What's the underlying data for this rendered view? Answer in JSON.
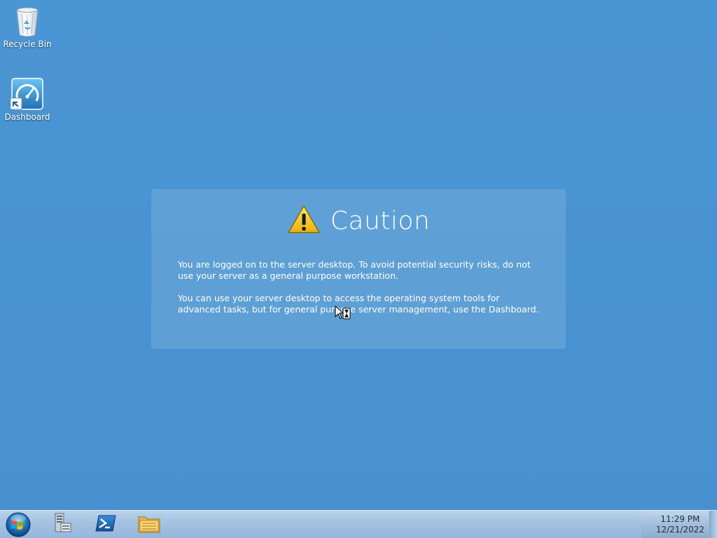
{
  "desktop": {
    "icons": [
      {
        "label": "Recycle Bin",
        "icon": "recycle-bin-icon"
      },
      {
        "label": "Dashboard",
        "icon": "dashboard-icon"
      }
    ]
  },
  "caution": {
    "title": "Caution",
    "icon": "warning-icon",
    "paragraph1": "You are logged on to the server desktop. To avoid potential security risks, do not use your server as a general purpose workstation.",
    "paragraph2": "You can use your server desktop to access the operating system tools for advanced tasks, but for general purpose server management, use the Dashboard."
  },
  "taskbar": {
    "start_icon": "windows-start-icon",
    "pinned": [
      {
        "icon": "server-manager-icon"
      },
      {
        "icon": "powershell-icon"
      },
      {
        "icon": "file-explorer-icon"
      }
    ],
    "clock": {
      "time": "11:29 PM",
      "date": "12/21/2022"
    }
  },
  "colors": {
    "desktop_background": "#4894d2",
    "taskbar": "#a6c3e2",
    "warning_yellow": "#f3c515"
  }
}
